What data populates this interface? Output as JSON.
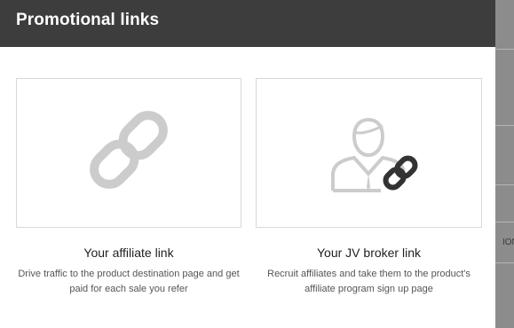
{
  "modal": {
    "title": "Promotional links"
  },
  "cards": [
    {
      "title": "Your affiliate link",
      "description": "Drive traffic to the product destination page and get paid for each sale you refer",
      "icon": "chain-link-icon"
    },
    {
      "title": "Your JV broker link",
      "description": "Recruit affiliates and take them to the product's affiliate program sign up page",
      "icon": "person-with-link-icon"
    }
  ],
  "background": {
    "partial_text": "ION"
  },
  "colors": {
    "header_bg": "#3d3d3d",
    "icon_gray": "#cccccc",
    "icon_dark": "#333333",
    "card_border": "#d9d9d9"
  }
}
